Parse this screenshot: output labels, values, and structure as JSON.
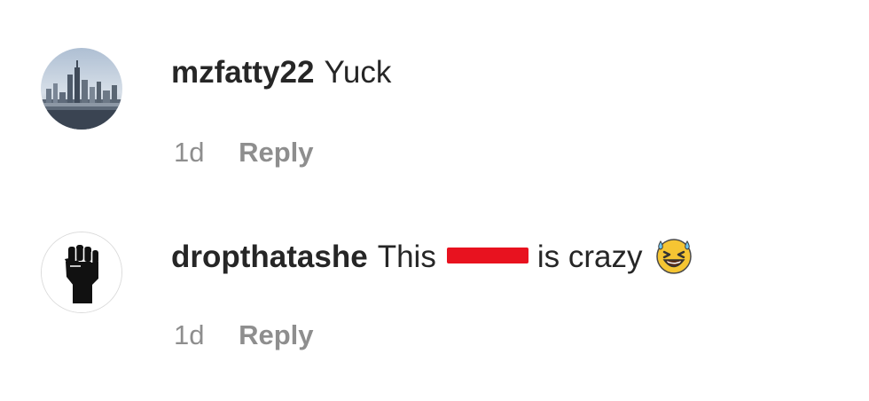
{
  "comments": [
    {
      "username": "mzfatty22",
      "text": "Yuck",
      "time": "1d",
      "reply_label": "Reply",
      "avatar_icon": "city-skyline-avatar"
    },
    {
      "username": "dropthatashe",
      "text_before": "This",
      "text_after": "is crazy",
      "time": "1d",
      "reply_label": "Reply",
      "avatar_icon": "raised-fist-avatar",
      "redaction_color": "#e8121f",
      "emoji": "grinning-squinting-face-with-sweat"
    }
  ],
  "colors": {
    "text": "#262626",
    "secondary": "#8e8e8e",
    "background": "#ffffff"
  }
}
